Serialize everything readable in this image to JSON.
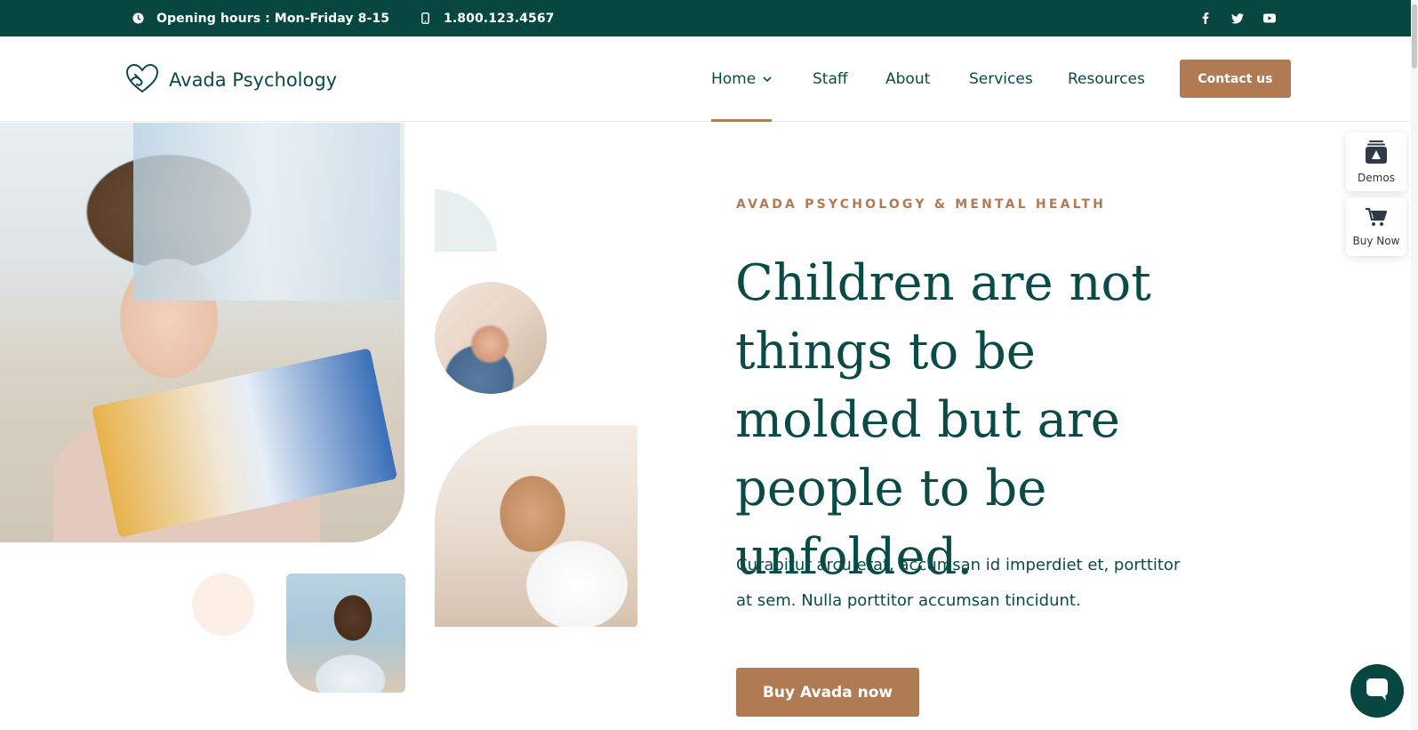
{
  "topbar": {
    "hours": "Opening hours : Mon-Friday 8-15",
    "phone": "1.800.123.4567",
    "social_icons": [
      "facebook-icon",
      "twitter-icon",
      "youtube-icon"
    ]
  },
  "header": {
    "logo_text": "Avada Psychology",
    "nav": [
      {
        "label": "Home",
        "active": true,
        "has_dropdown": true
      },
      {
        "label": "Staff"
      },
      {
        "label": "About"
      },
      {
        "label": "Services"
      },
      {
        "label": "Resources"
      }
    ],
    "contact_label": "Contact us"
  },
  "side_widgets": {
    "demos_label": "Demos",
    "buy_label": "Buy Now"
  },
  "hero": {
    "eyebrow": "AVADA PSYCHOLOGY & MENTAL HEALTH",
    "headline": "Children are not things to be molded but are people to be unfolded.",
    "lede": "Curabitur arcu erat, accumsan id imperdiet et, porttitor at sem. Nulla porttitor accumsan tincidunt.",
    "cta_label": "Buy Avada now"
  },
  "colors": {
    "brand_dark": "#07473f",
    "accent": "#b07a53",
    "text": "#0a4a47"
  }
}
